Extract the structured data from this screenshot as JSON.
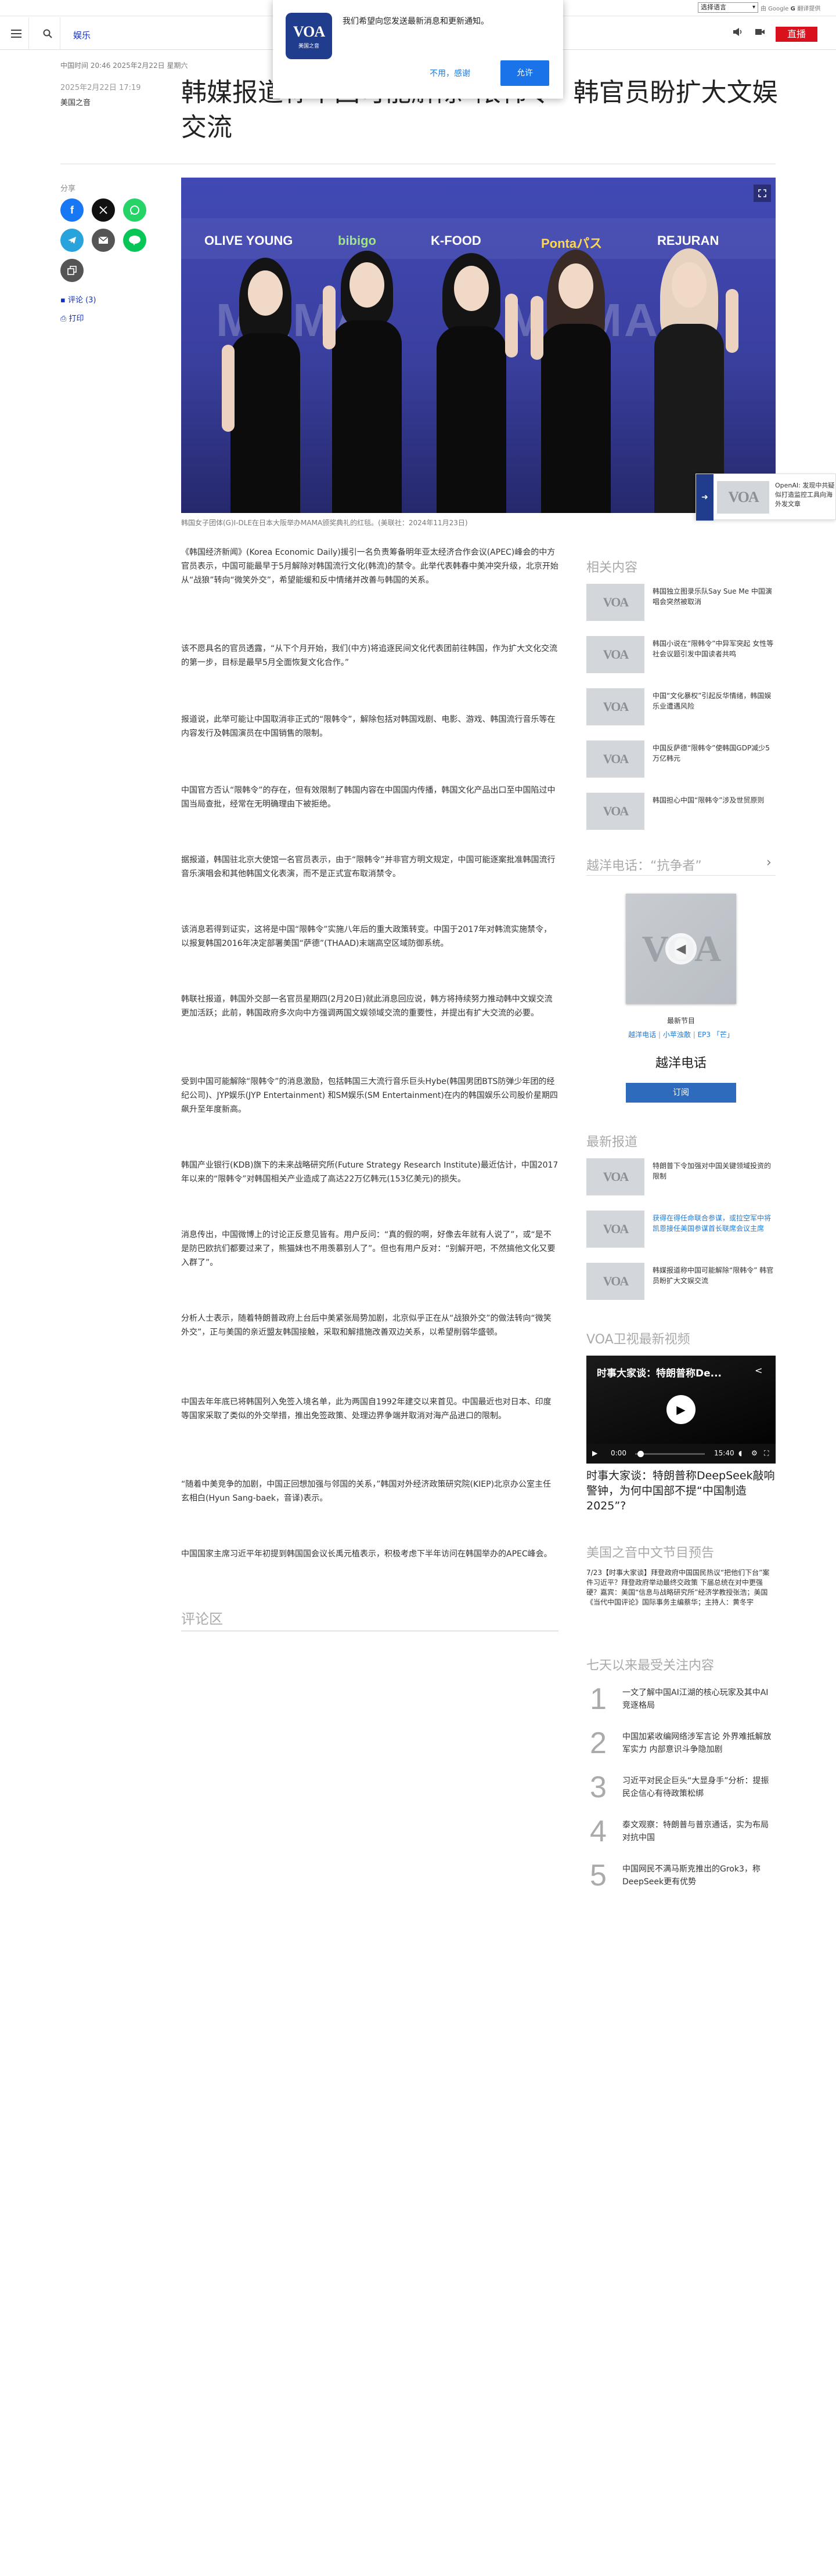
{
  "topbar": {
    "language_select": "选择语言",
    "translate_powered": "由 Google",
    "translate_label": "翻译提供"
  },
  "header": {
    "section": "娱乐",
    "live_label": "直播"
  },
  "popup": {
    "logo_text": "VOA",
    "logo_sub": "美国之音",
    "message": "我们希望向您发送最新消息和更新通知。",
    "decline": "不用，感谢",
    "allow": "允许"
  },
  "article": {
    "dateline": "中国时间 20:46 2025年2月22日 星期六",
    "published": "2025年2月22日 17:19",
    "byline": "美国之音",
    "headline": "韩媒报道称中国可能解除“限韩令” 韩官员盼扩大文娱交流",
    "image_caption": "韩国女子团体(G)I-DLE在日本大阪举办MAMA颁奖典礼的红毯。(美联社：2024年11月23日)",
    "paragraphs": [
      "《韩国经济新闻》(Korea Economic Daily)援引一名负责筹备明年亚太经济合作会议(APEC)峰会的中方官员表示，中国可能最早于5月解除对韩国流行文化(韩流)的禁令。此举代表韩春中美冲突升级，北京开始从“战狼”转向“微笑外交”，希望能缓和反中情绪并改善与韩国的关系。",
      "该不愿具名的官员透露，“从下个月开始，我们(中方)将追逐民间文化代表团前往韩国，作为扩大文化交流的第一步，目标是最早5月全面恢复文化合作。”",
      "报道说，此举可能让中国取消非正式的“限韩令”，解除包括对韩国戏剧、电影、游戏、韩国流行音乐等在内容发行及韩国演员在中国销售的限制。",
      "中国官方否认“限韩令”的存在，但有效限制了韩国内容在中国国内传播，韩国文化产品出口至中国陷过中国当局查批，经常在无明确理由下被拒绝。",
      "据报道，韩国驻北京大使馆一名官员表示，由于“限韩令”并非官方明文规定，中国可能逐案批准韩国流行音乐演唱会和其他韩国文化表演，而不是正式宣布取消禁令。",
      "该消息若得到证实，这将是中国“限韩令”实施八年后的重大政策转变。中国于2017年对韩流实施禁令，以报复韩国2016年决定部署美国“萨德”(THAAD)末端高空区域防御系统。",
      "韩联社报道，韩国外交部一名官员星期四(2月20日)就此消息回应说，韩方将持续努力推动韩中文娱交流更加活跃；此前，韩国政府多次向中方强调两国文娱领域交流的重要性，并提出有扩大交流的必要。",
      "受到中国可能解除“限韩令”的消息激励，包括韩国三大流行音乐巨头Hybe(韩国男团BTS防弹少年团的经纪公司)、JYP娱乐(JYP Entertainment) 和SM娱乐(SM Entertainment)在内的韩国娱乐公司股价星期四飙升至年度新高。",
      "韩国产业银行(KDB)旗下的未来战略研究所(Future Strategy Research Institute)最近估计，中国2017年以来的“限韩令”对韩国相关产业造成了高达22万亿韩元(153亿美元)的损失。",
      "消息传出，中国微博上的讨论正反意见皆有。用户反问：“真的假的啊，好像去年就有人说了”，或“是不是防巴欧抗们都要过来了，熊猫妹也不用羡慕别人了”。但也有用户反对：“别解开吧，不然搞他文化又要入群了”。",
      "分析人士表示，随着特朗普政府上台后中美紧张局势加剧，北京似乎正在从“战狼外交”的做法转向“微笑外交”，正与美国的亲近盟友韩国接触，采取和解措施改善双边关系，以希望削弱华盛顿。",
      "中国去年年底已将韩国列入免签入境名单，此为两国自1992年建交以来首见。中国最近也对日本、印度等国家采取了类似的外交举措，推出免签政策、处理边界争端并取消对海产品进口的限制。",
      "“随着中美竞争的加剧，中国正回想加强与邻国的关系，”韩国对外经济政策研究院(KIEP)北京办公室主任玄相白(Hyun Sang-baek，音译)表示。",
      "中国国家主席习近平年初提到韩国国会议长禹元植表示，积极考虑下半年访问在韩国举办的APEC峰会。"
    ],
    "comments_heading": "评论区"
  },
  "share": {
    "label": "分享",
    "comments_link": "评论 (3)",
    "print_link": "打印"
  },
  "hero": {
    "sponsors": [
      "OLIVE YOUNG",
      "bibigo",
      "K-FOOD",
      "Pontaパス",
      "REJURAN"
    ],
    "watermark": "MAMA",
    "alt": "(G)I-DLE members on the red carpet"
  },
  "sidetab": {
    "text": "OpenAI: 发现中共疑似打造监控工具向海外发文章"
  },
  "related": {
    "heading": "相关内容",
    "items": [
      "韩国独立图录乐队Say Sue Me 中国演唱会突然被取消",
      "韩国小说在“限韩令”中异军突起 女性等社会议题引发中国读者共鸣",
      "中国“文化暴权”引起反华情绪，韩国娱乐业遭遇风险",
      "中国反萨德“限韩令”使韩国GDP减少5万亿韩元",
      "韩国担心中国“限韩令”涉及世贸原则"
    ]
  },
  "radio": {
    "heading": "越洋电话：“抗争者”",
    "card_label": "最新节目",
    "links": [
      "越洋电话",
      "小苹浊散",
      "EP3 「芒」"
    ],
    "title": "越洋电话",
    "subscribe": "订阅"
  },
  "latest": {
    "heading": "最新报道",
    "items": [
      "特朗普下令加强对中国关键领域投资的限制",
      "获得在得任命联合参谋，或拉空军中将凯恩接任美国参谋首长联席会议主席",
      "韩媒报道称中国可能解除“限韩令” 韩官员盼扩大文娱交流"
    ]
  },
  "video": {
    "heading": "VOA卫视最新视频",
    "title": "时事大家谈：特朗普称De...",
    "time_current": "0:00",
    "time_total": "15:40",
    "progress": 0.0,
    "caption": "时事大家谈：特朗普称DeepSeek敲响警钟，为何中国部不提“中国制造2025”?"
  },
  "program": {
    "heading": "美国之音中文节目预告",
    "text": "7/23【时事大家谈】拜登政府中国国民热议“把他们下台”案件习近平？拜登政府举动最终交政策 下届总统在对中更强硬？嘉宾：美国“信息与战略研究所”经济学教授张浩；美国《当代中国评论》国际事务主编蔡华；主持人：黄冬宇"
  },
  "popular": {
    "heading": "七天以来最受关注内容",
    "items": [
      {
        "num": "1",
        "text": "一文了解中国AI江湖的核心玩家及其中AI竞逐格局"
      },
      {
        "num": "2",
        "text": "中国加紧收编网络涉军言论 外界难抵解放军实力 内部意识斗争隐加剧"
      },
      {
        "num": "3",
        "text": "习近平对民企巨头“大显身手”分析：提振民企信心有待政策松绑"
      },
      {
        "num": "4",
        "text": "泰文观察：特朗普与普京通话，实为布局对抗中国"
      },
      {
        "num": "5",
        "text": "中国网民不满马斯克推出的Grok3，称DeepSeek更有优势"
      }
    ]
  },
  "colors": {
    "brand_blue": "#1f3c8d",
    "link_blue": "#1330bf",
    "live_red": "#d8111c",
    "allow_blue": "#1a73e8"
  },
  "icons": [
    "menu-icon",
    "search-icon",
    "audio-icon",
    "video-icon",
    "expand-icon",
    "comment-icon",
    "print-icon",
    "play-icon",
    "share-icon",
    "fullscreen-icon",
    "volume-icon",
    "settings-icon"
  ]
}
